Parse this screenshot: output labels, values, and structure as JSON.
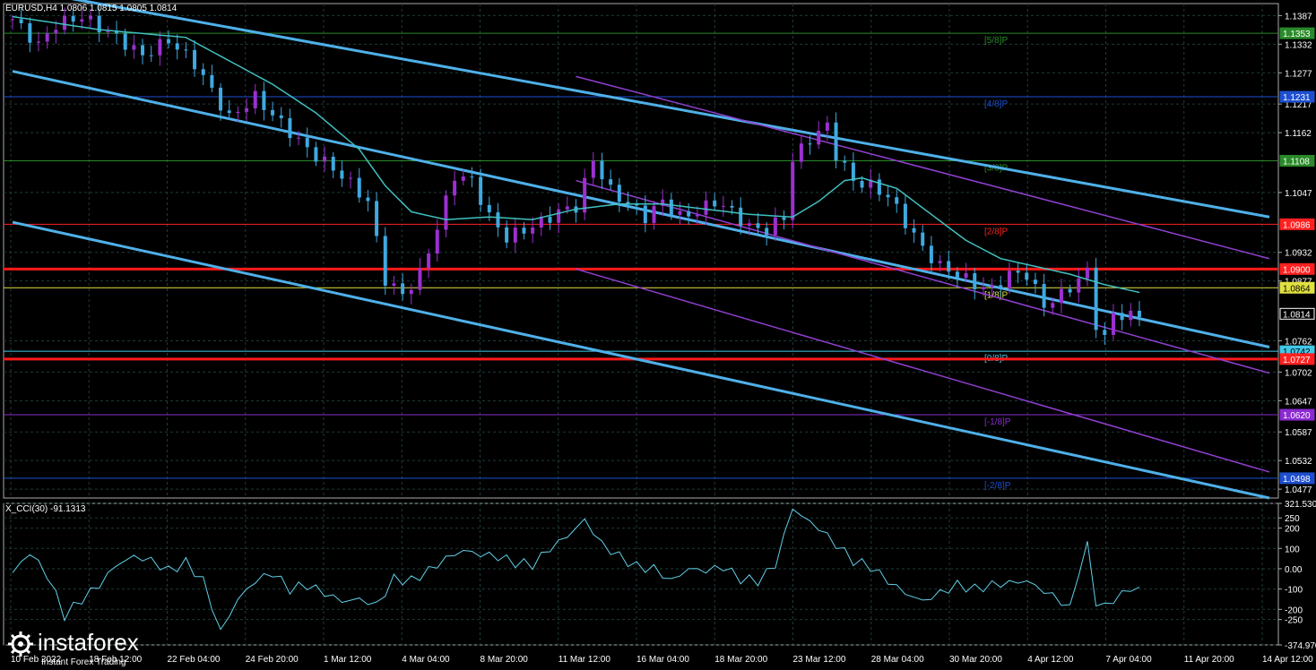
{
  "header": {
    "symbol_line": "EURUSD,H4  1.0806 1.0815 1.0805 1.0814"
  },
  "indicator": {
    "title": "X_CCI(30) -91.1313"
  },
  "brand": {
    "logo_text": "instaforex",
    "tagline": "Instant Forex Trading",
    "logo_icon": "gear-logo-icon"
  },
  "colors": {
    "background": "#000000",
    "grid": "#1f3a3a",
    "bull": "#9b30d0",
    "bear": "#3fa9e0",
    "ma": "#40c0c0",
    "channel": "#4fb0e8",
    "inner_channel": "#9040d0",
    "red_level": "#ff1a1a",
    "cci": "#60d0e8"
  },
  "chart_data": [
    {
      "type": "candlestick",
      "symbol": "EURUSD",
      "timeframe": "H4",
      "ohlc_last": {
        "open": 1.0806,
        "high": 1.0815,
        "low": 1.0805,
        "close": 1.0814
      },
      "y_ticks": [
        "1.1387",
        "1.1332",
        "1.1277",
        "1.1217",
        "1.1162",
        "1.1047",
        "1.0932",
        "1.0877",
        "1.0762",
        "1.0702",
        "1.0647",
        "1.0587",
        "1.0532",
        "1.0477"
      ],
      "x_ticks": [
        "10 Feb 2022",
        "18 Feb 12:00",
        "22 Feb 04:00",
        "24 Feb 20:00",
        "1 Mar 12:00",
        "4 Mar 04:00",
        "8 Mar 20:00",
        "11 Mar 12:00",
        "16 Mar 04:00",
        "18 Mar 20:00",
        "23 Mar 12:00",
        "28 Mar 04:00",
        "30 Mar 20:00",
        "4 Apr 12:00",
        "7 Apr 04:00",
        "11 Apr 20:00",
        "14 Apr 12:00"
      ],
      "ylim": [
        1.046,
        1.141
      ],
      "price_path": [
        [
          0,
          1.138
        ],
        [
          3,
          1.133
        ],
        [
          5,
          1.137
        ],
        [
          8,
          1.1385
        ],
        [
          12,
          1.1345
        ],
        [
          15,
          1.131
        ],
        [
          18,
          1.134
        ],
        [
          21,
          1.1295
        ],
        [
          25,
          1.119
        ],
        [
          28,
          1.123
        ],
        [
          31,
          1.118
        ],
        [
          34,
          1.113
        ],
        [
          38,
          1.108
        ],
        [
          41,
          1.103
        ],
        [
          43,
          1.088
        ],
        [
          45,
          1.085
        ],
        [
          47,
          1.089
        ],
        [
          49,
          1.098
        ],
        [
          51,
          1.108
        ],
        [
          53,
          1.107
        ],
        [
          55,
          1.1
        ],
        [
          57,
          1.096
        ],
        [
          59,
          1.0975
        ],
        [
          61,
          1.099
        ],
        [
          63,
          1.101
        ],
        [
          65,
          1.102
        ],
        [
          67,
          1.111
        ],
        [
          69,
          1.105
        ],
        [
          71,
          1.1025
        ],
        [
          73,
          1.1
        ],
        [
          75,
          1.103
        ],
        [
          77,
          1.1
        ],
        [
          79,
          1.101
        ],
        [
          81,
          1.103
        ],
        [
          83,
          1.101
        ],
        [
          85,
          1.098
        ],
        [
          87,
          1.0975
        ],
        [
          89,
          1.1
        ],
        [
          90,
          1.111
        ],
        [
          92,
          1.115
        ],
        [
          94,
          1.1175
        ],
        [
          95,
          1.112
        ],
        [
          97,
          1.107
        ],
        [
          99,
          1.106
        ],
        [
          101,
          1.104
        ],
        [
          103,
          1.099
        ],
        [
          105,
          1.094
        ],
        [
          107,
          1.0905
        ],
        [
          109,
          1.089
        ],
        [
          111,
          1.087
        ],
        [
          113,
          1.086
        ],
        [
          115,
          1.089
        ],
        [
          117,
          1.089
        ],
        [
          119,
          1.083
        ],
        [
          121,
          1.085
        ],
        [
          123,
          1.088
        ],
        [
          124,
          1.0895
        ],
        [
          125,
          1.0795
        ],
        [
          126,
          1.0765
        ],
        [
          127,
          1.0815
        ],
        [
          129,
          1.0808
        ],
        [
          130,
          1.0814
        ]
      ],
      "ma_path": [
        [
          0,
          1.1385
        ],
        [
          10,
          1.136
        ],
        [
          20,
          1.1345
        ],
        [
          25,
          1.13
        ],
        [
          30,
          1.1255
        ],
        [
          35,
          1.12
        ],
        [
          40,
          1.113
        ],
        [
          43,
          1.106
        ],
        [
          46,
          1.101
        ],
        [
          50,
          1.0995
        ],
        [
          55,
          1.1
        ],
        [
          60,
          1.0995
        ],
        [
          65,
          1.1015
        ],
        [
          70,
          1.1025
        ],
        [
          75,
          1.1025
        ],
        [
          80,
          1.1015
        ],
        [
          85,
          1.1005
        ],
        [
          90,
          1.1
        ],
        [
          93,
          1.103
        ],
        [
          96,
          1.107
        ],
        [
          98,
          1.1075
        ],
        [
          102,
          1.1055
        ],
        [
          106,
          1.1005
        ],
        [
          110,
          1.0955
        ],
        [
          114,
          1.092
        ],
        [
          118,
          1.0905
        ],
        [
          122,
          1.089
        ],
        [
          126,
          1.087
        ],
        [
          130,
          1.0855
        ]
      ],
      "bar_count": 131,
      "murrey_levels": [
        {
          "label": "[5/8]P",
          "price": 1.1353,
          "color": "#2a8a2a"
        },
        {
          "label": "[4/8]P",
          "price": 1.1231,
          "color": "#1e4fd0"
        },
        {
          "label": "[3/8]P",
          "price": 1.1108,
          "color": "#2a8a2a"
        },
        {
          "label": "[2/8]P",
          "price": 1.0986,
          "color": "#ff2020"
        },
        {
          "label": "[1/8]P",
          "price": 1.0864,
          "color": "#e0e040"
        },
        {
          "label": "[0/8]P",
          "price": 1.0742,
          "color": "#40c8e8"
        },
        {
          "label": "[-1/8]P",
          "price": 1.062,
          "color": "#8a2ad0"
        },
        {
          "label": "[-2/8]P",
          "price": 1.0498,
          "color": "#1e4fd0"
        }
      ],
      "level_tags": [
        {
          "text": "1.1353",
          "price": 1.1353,
          "bg": "#2a8a2a",
          "fg": "#ffffff"
        },
        {
          "text": "1.1231",
          "price": 1.1231,
          "bg": "#1e4fd0",
          "fg": "#ffffff"
        },
        {
          "text": "1.1108",
          "price": 1.1108,
          "bg": "#2a8a2a",
          "fg": "#ffffff"
        },
        {
          "text": "1.0986",
          "price": 1.0986,
          "bg": "#ff2020",
          "fg": "#ffffff"
        },
        {
          "text": "1.0900",
          "price": 1.09,
          "bg": "#ff2020",
          "fg": "#ffffff"
        },
        {
          "text": "1.0864",
          "price": 1.0864,
          "bg": "#e0e040",
          "fg": "#000000"
        },
        {
          "text": "1.0814",
          "price": 1.0814,
          "bg": "#000000",
          "fg": "#ffffff"
        },
        {
          "text": "1.0742",
          "price": 1.0742,
          "bg": "#40c8e8",
          "fg": "#000000"
        },
        {
          "text": "1.0727",
          "price": 1.0727,
          "bg": "#ff2020",
          "fg": "#ffffff"
        },
        {
          "text": "1.0620",
          "price": 1.062,
          "bg": "#8a2ad0",
          "fg": "#ffffff"
        },
        {
          "text": "1.0498",
          "price": 1.0498,
          "bg": "#1e4fd0",
          "fg": "#ffffff"
        }
      ],
      "red_lines": [
        1.09,
        1.0727
      ],
      "channel_lines": [
        {
          "color": "#4fb0e8",
          "p1": [
            0,
            1.144
          ],
          "p2": [
            145,
            1.1
          ]
        },
        {
          "color": "#4fb0e8",
          "p1": [
            0,
            1.128
          ],
          "p2": [
            145,
            1.075
          ]
        },
        {
          "color": "#4fb0e8",
          "p1": [
            0,
            1.099
          ],
          "p2": [
            145,
            1.046
          ]
        },
        {
          "color": "#9040d0",
          "p1": [
            65,
            1.127
          ],
          "p2": [
            145,
            1.092
          ]
        },
        {
          "color": "#9040d0",
          "p1": [
            65,
            1.107
          ],
          "p2": [
            145,
            1.07
          ]
        },
        {
          "color": "#9040d0",
          "p1": [
            65,
            1.09
          ],
          "p2": [
            145,
            1.051
          ]
        }
      ]
    },
    {
      "type": "line",
      "name": "X_CCI(30)",
      "last_value": -91.1313,
      "ylim": [
        -374.9704,
        321.5307
      ],
      "y_ticks": [
        "321.5307",
        "250",
        "200",
        "100",
        "0.00",
        "-100",
        "-200",
        "-250",
        "-374.9704"
      ],
      "values": [
        [
          0,
          -20
        ],
        [
          2,
          80
        ],
        [
          4,
          -30
        ],
        [
          6,
          -230
        ],
        [
          8,
          -150
        ],
        [
          10,
          -80
        ],
        [
          12,
          20
        ],
        [
          14,
          60
        ],
        [
          16,
          40
        ],
        [
          18,
          -10
        ],
        [
          20,
          30
        ],
        [
          22,
          -60
        ],
        [
          24,
          -310
        ],
        [
          26,
          -150
        ],
        [
          28,
          -60
        ],
        [
          30,
          -20
        ],
        [
          32,
          -100
        ],
        [
          34,
          -80
        ],
        [
          36,
          -120
        ],
        [
          38,
          -160
        ],
        [
          40,
          -150
        ],
        [
          42,
          -180
        ],
        [
          44,
          -50
        ],
        [
          46,
          -60
        ],
        [
          48,
          -10
        ],
        [
          50,
          50
        ],
        [
          52,
          90
        ],
        [
          54,
          70
        ],
        [
          56,
          60
        ],
        [
          58,
          30
        ],
        [
          60,
          20
        ],
        [
          62,
          100
        ],
        [
          64,
          160
        ],
        [
          66,
          240
        ],
        [
          68,
          120
        ],
        [
          70,
          60
        ],
        [
          72,
          10
        ],
        [
          74,
          0
        ],
        [
          76,
          -60
        ],
        [
          78,
          0
        ],
        [
          80,
          -10
        ],
        [
          82,
          10
        ],
        [
          84,
          -50
        ],
        [
          86,
          -60
        ],
        [
          88,
          20
        ],
        [
          90,
          300
        ],
        [
          91,
          260
        ],
        [
          93,
          200
        ],
        [
          95,
          120
        ],
        [
          97,
          40
        ],
        [
          99,
          10
        ],
        [
          101,
          -60
        ],
        [
          103,
          -120
        ],
        [
          105,
          -160
        ],
        [
          107,
          -120
        ],
        [
          109,
          -80
        ],
        [
          111,
          -100
        ],
        [
          113,
          -80
        ],
        [
          115,
          -70
        ],
        [
          117,
          -60
        ],
        [
          119,
          -110
        ],
        [
          121,
          -160
        ],
        [
          122,
          -200
        ],
        [
          123,
          -10
        ],
        [
          124,
          110
        ],
        [
          125,
          -160
        ],
        [
          126,
          -190
        ],
        [
          128,
          -120
        ],
        [
          130,
          -91
        ]
      ]
    }
  ]
}
